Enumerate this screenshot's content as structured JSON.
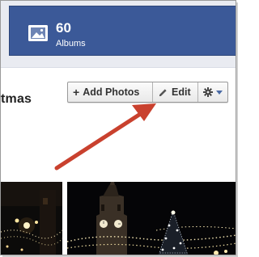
{
  "albums": {
    "count": "60",
    "label": "Albums",
    "icon": "photo-album-icon"
  },
  "page_title_fragment": "tmas",
  "toolbar": {
    "add_photos": {
      "icon": "plus",
      "label": "Add Photos"
    },
    "edit": {
      "icon": "pencil-icon",
      "label": "Edit"
    },
    "options": {
      "icon": "gear-icon",
      "caret": "chevron-down-icon"
    }
  },
  "annotation": {
    "type": "red-arrow",
    "points_to": "edit"
  },
  "photos": [
    {
      "name": "photo-thumbnail-1",
      "subject": "street lights at night"
    },
    {
      "name": "photo-thumbnail-2",
      "subject": "clock tower and christmas tree at night"
    }
  ],
  "colors": {
    "brand_blue": "#3b5998",
    "header_bg": "#e9ebf1",
    "arrow_red": "#c9412e"
  }
}
